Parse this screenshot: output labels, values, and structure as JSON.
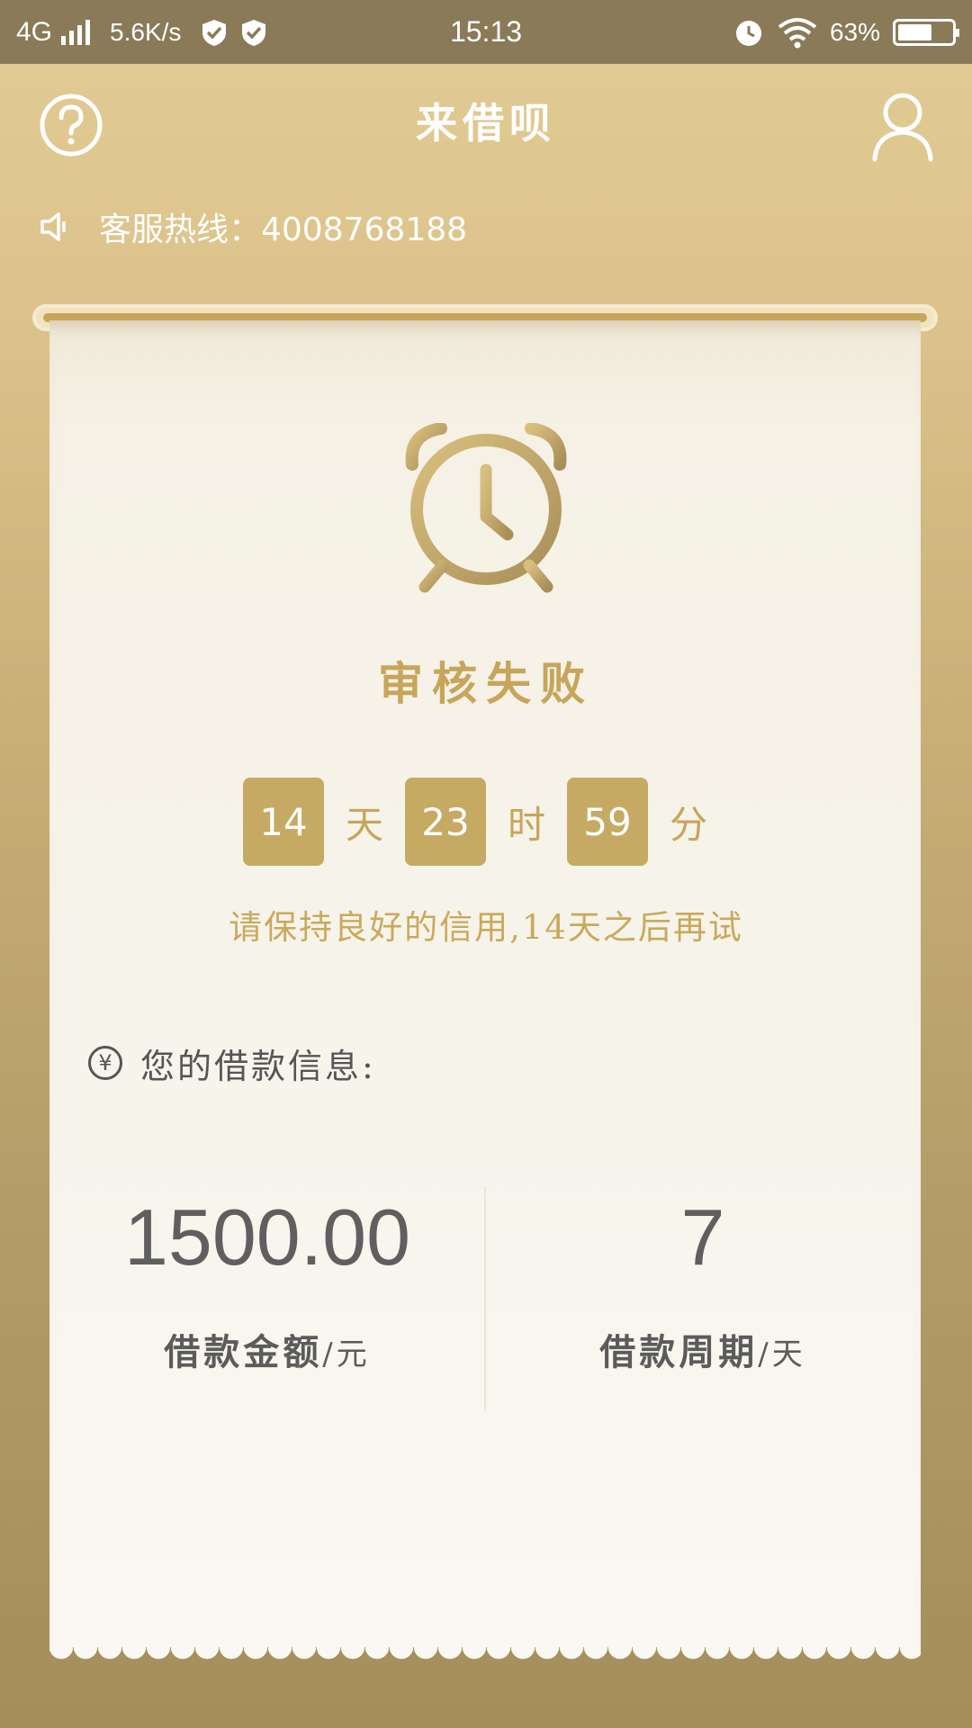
{
  "status_bar": {
    "network": "4G",
    "speed": "5.6K/s",
    "time": "15:13",
    "battery_percent": "63%",
    "battery_level": 0.63
  },
  "header": {
    "title": "来借呗",
    "help_icon": "question-circle-icon",
    "user_icon": "user-icon"
  },
  "hotline": {
    "text": "客服热线：4008768188",
    "icon": "speaker-icon"
  },
  "review": {
    "status_text": "审核失败",
    "countdown": {
      "days": "14",
      "days_unit": "天",
      "hours": "23",
      "hours_unit": "时",
      "minutes": "59",
      "minutes_unit": "分"
    },
    "tip": "请保持良好的信用,14天之后再试"
  },
  "loan_info": {
    "heading": "您的借款信息:",
    "yen_symbol": "¥",
    "amount_value": "1500.00",
    "amount_label": "借款金额",
    "amount_unit": "/元",
    "period_value": "7",
    "period_label": "借款周期",
    "period_unit": "/天"
  },
  "colors": {
    "gold": "#c6aa64",
    "status_bar": "#8a7a58",
    "card": "#f7f4ec"
  }
}
